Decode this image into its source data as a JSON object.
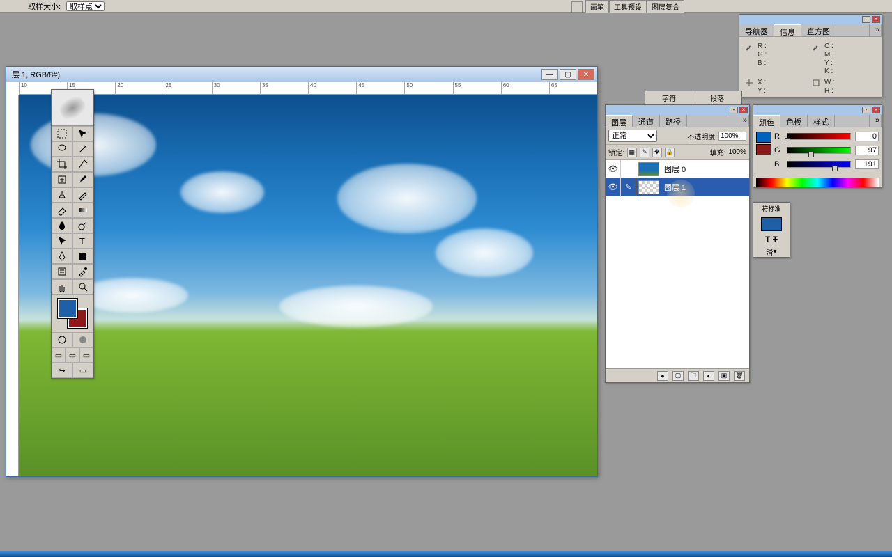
{
  "options_bar": {
    "sample_size_label": "取样大小:",
    "sample_size_val": "取样点"
  },
  "top_tabs": {
    "brush": "画笔",
    "tool_presets": "工具预设",
    "layer_comps": "图层复合"
  },
  "doc": {
    "title": "层 1, RGB/8#)",
    "ruler_ticks": [
      "10",
      "15",
      "20",
      "25",
      "30",
      "35",
      "40",
      "45",
      "50",
      "55",
      "60",
      "65"
    ]
  },
  "info_panel": {
    "tabs": {
      "navigator": "导航器",
      "info": "信息",
      "histogram": "直方图"
    },
    "rgb": {
      "R": "R :",
      "G": "G :",
      "B": "B :"
    },
    "cmyk": {
      "C": "C :",
      "M": "M :",
      "Y": "Y :",
      "K": "K :"
    },
    "xy": {
      "X": "X :",
      "Y": "Y :"
    },
    "wh": {
      "W": "W :",
      "H": "H :"
    }
  },
  "color_panel": {
    "tabs": {
      "color": "颜色",
      "swatches": "色板",
      "styles": "样式"
    },
    "r": {
      "lbl": "R",
      "val": "0"
    },
    "g": {
      "lbl": "G",
      "val": "97"
    },
    "b": {
      "lbl": "B",
      "val": "191"
    },
    "fg": "#0061bf",
    "bg": "#8b1a1a"
  },
  "char_panel": {
    "header": "符标准",
    "T1": "T",
    "T2": "T",
    "smooth": "滑"
  },
  "stub_panel": {
    "a": "字符",
    "b": "段落"
  },
  "layers_panel": {
    "tabs": {
      "layers": "图层",
      "channels": "通道",
      "paths": "路径"
    },
    "blend_mode": "正常",
    "opacity_label": "不透明度:",
    "opacity_val": "100%",
    "lock_label": "锁定:",
    "fill_label": "填充:",
    "fill_val": "100%",
    "layers": [
      {
        "name": "图层 0",
        "thumb": "sky"
      },
      {
        "name": "图层 1",
        "thumb": "check"
      }
    ]
  },
  "colors": {
    "fg": "#1e5fa5",
    "bg": "#8b1a1a"
  }
}
